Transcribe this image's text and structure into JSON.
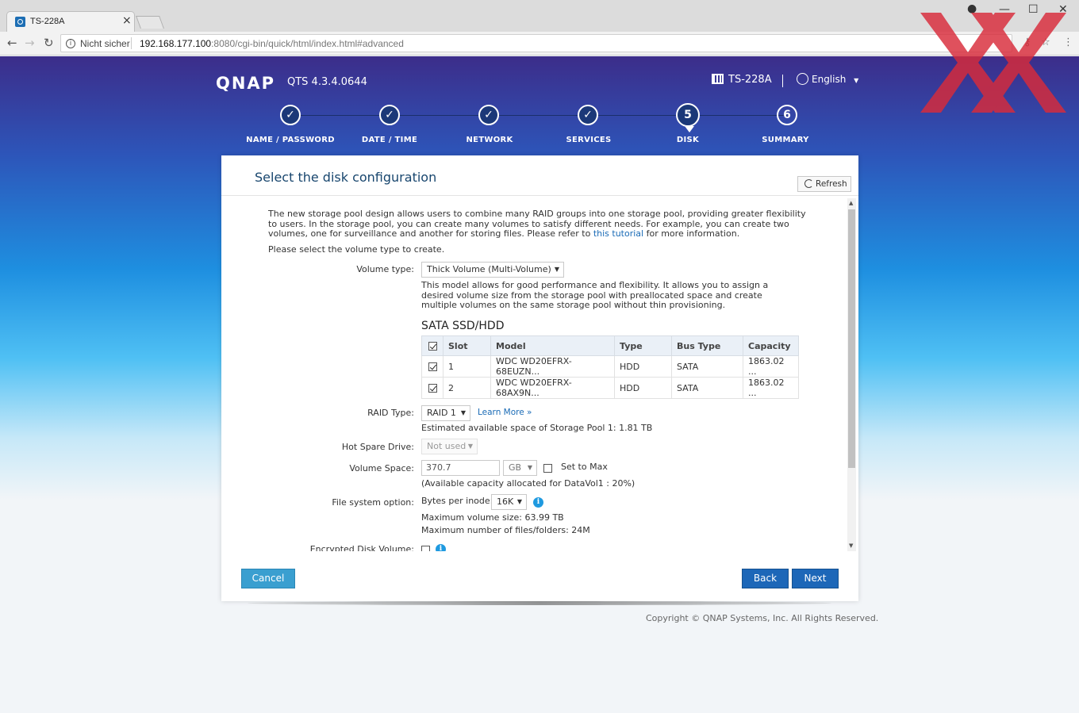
{
  "browser": {
    "tab_title": "TS-228A",
    "tab_close": "×",
    "security_label": "Nicht sicher",
    "url_host": "192.168.177.100",
    "url_rest": ":8080/cgi-bin/quick/html/index.html#advanced"
  },
  "header": {
    "logo": "QNAP",
    "version": "QTS 4.3.4.0644",
    "device_name": "TS-228A",
    "language": "English"
  },
  "steps": [
    {
      "label": "NAME / PASSWORD",
      "marker": "✓",
      "state": "done"
    },
    {
      "label": "DATE / TIME",
      "marker": "✓",
      "state": "done"
    },
    {
      "label": "NETWORK",
      "marker": "✓",
      "state": "done"
    },
    {
      "label": "SERVICES",
      "marker": "✓",
      "state": "done"
    },
    {
      "label": "DISK",
      "marker": "5",
      "state": "current"
    },
    {
      "label": "SUMMARY",
      "marker": "6",
      "state": "pending"
    }
  ],
  "dialog": {
    "title": "Select the disk configuration",
    "refresh_label": "Refresh",
    "intro_before_link": "The new storage pool design allows users to combine many RAID groups into one storage pool, providing greater flexibility to users. In the storage pool, you can create many volumes to satisfy different needs. For example, you can create two volumes, one for surveillance and another for storing files. Please refer to",
    "intro_link": "this tutorial",
    "intro_after_link": "for more information.",
    "prompt": "Please select the volume type to create.",
    "volume_type_label": "Volume type:",
    "volume_type_value": "Thick Volume (Multi-Volume)",
    "volume_type_desc": "This model allows for good performance and flexibility. It allows you to assign a desired volume size from the storage pool with preallocated space and create multiple volumes on the same storage pool without thin provisioning.",
    "disk_section_title": "SATA SSD/HDD",
    "table_headers": [
      "Slot",
      "Model",
      "Type",
      "Bus Type",
      "Capacity"
    ],
    "disks": [
      {
        "slot": "1",
        "model": "WDC WD20EFRX-68EUZN...",
        "type": "HDD",
        "bus": "SATA",
        "capacity": "1863.02 ..."
      },
      {
        "slot": "2",
        "model": "WDC WD20EFRX-68AX9N...",
        "type": "HDD",
        "bus": "SATA",
        "capacity": "1863.02 ..."
      }
    ],
    "raid_label": "RAID Type:",
    "raid_value": "RAID 1",
    "learn_more": "Learn More »",
    "estimated_space": "Estimated available space of Storage Pool 1: 1.81 TB",
    "hot_spare_label": "Hot Spare Drive:",
    "hot_spare_value": "Not used",
    "volume_space_label": "Volume Space:",
    "volume_space_value": "370.7",
    "volume_space_unit": "GB",
    "set_to_max": "Set to Max",
    "available_capacity": "(Available capacity allocated for DataVol1 : 20%)",
    "fs_label": "File system option:",
    "bytes_per_inode_label": "Bytes per inode:",
    "bytes_per_inode_value": "16K",
    "max_volume_size": "Maximum volume size: 63.99 TB",
    "max_files": "Maximum number of files/folders: 24M",
    "encrypted_label": "Encrypted Disk Volume:",
    "cancel": "Cancel",
    "back": "Back",
    "next": "Next"
  },
  "footer": {
    "copyright": "Copyright © QNAP Systems, Inc. All Rights Reserved."
  },
  "colors": {
    "primary_button": "#1d67b8",
    "cancel_button": "#3a9fd0",
    "step_done": "#1b3878",
    "title": "#18466e"
  }
}
